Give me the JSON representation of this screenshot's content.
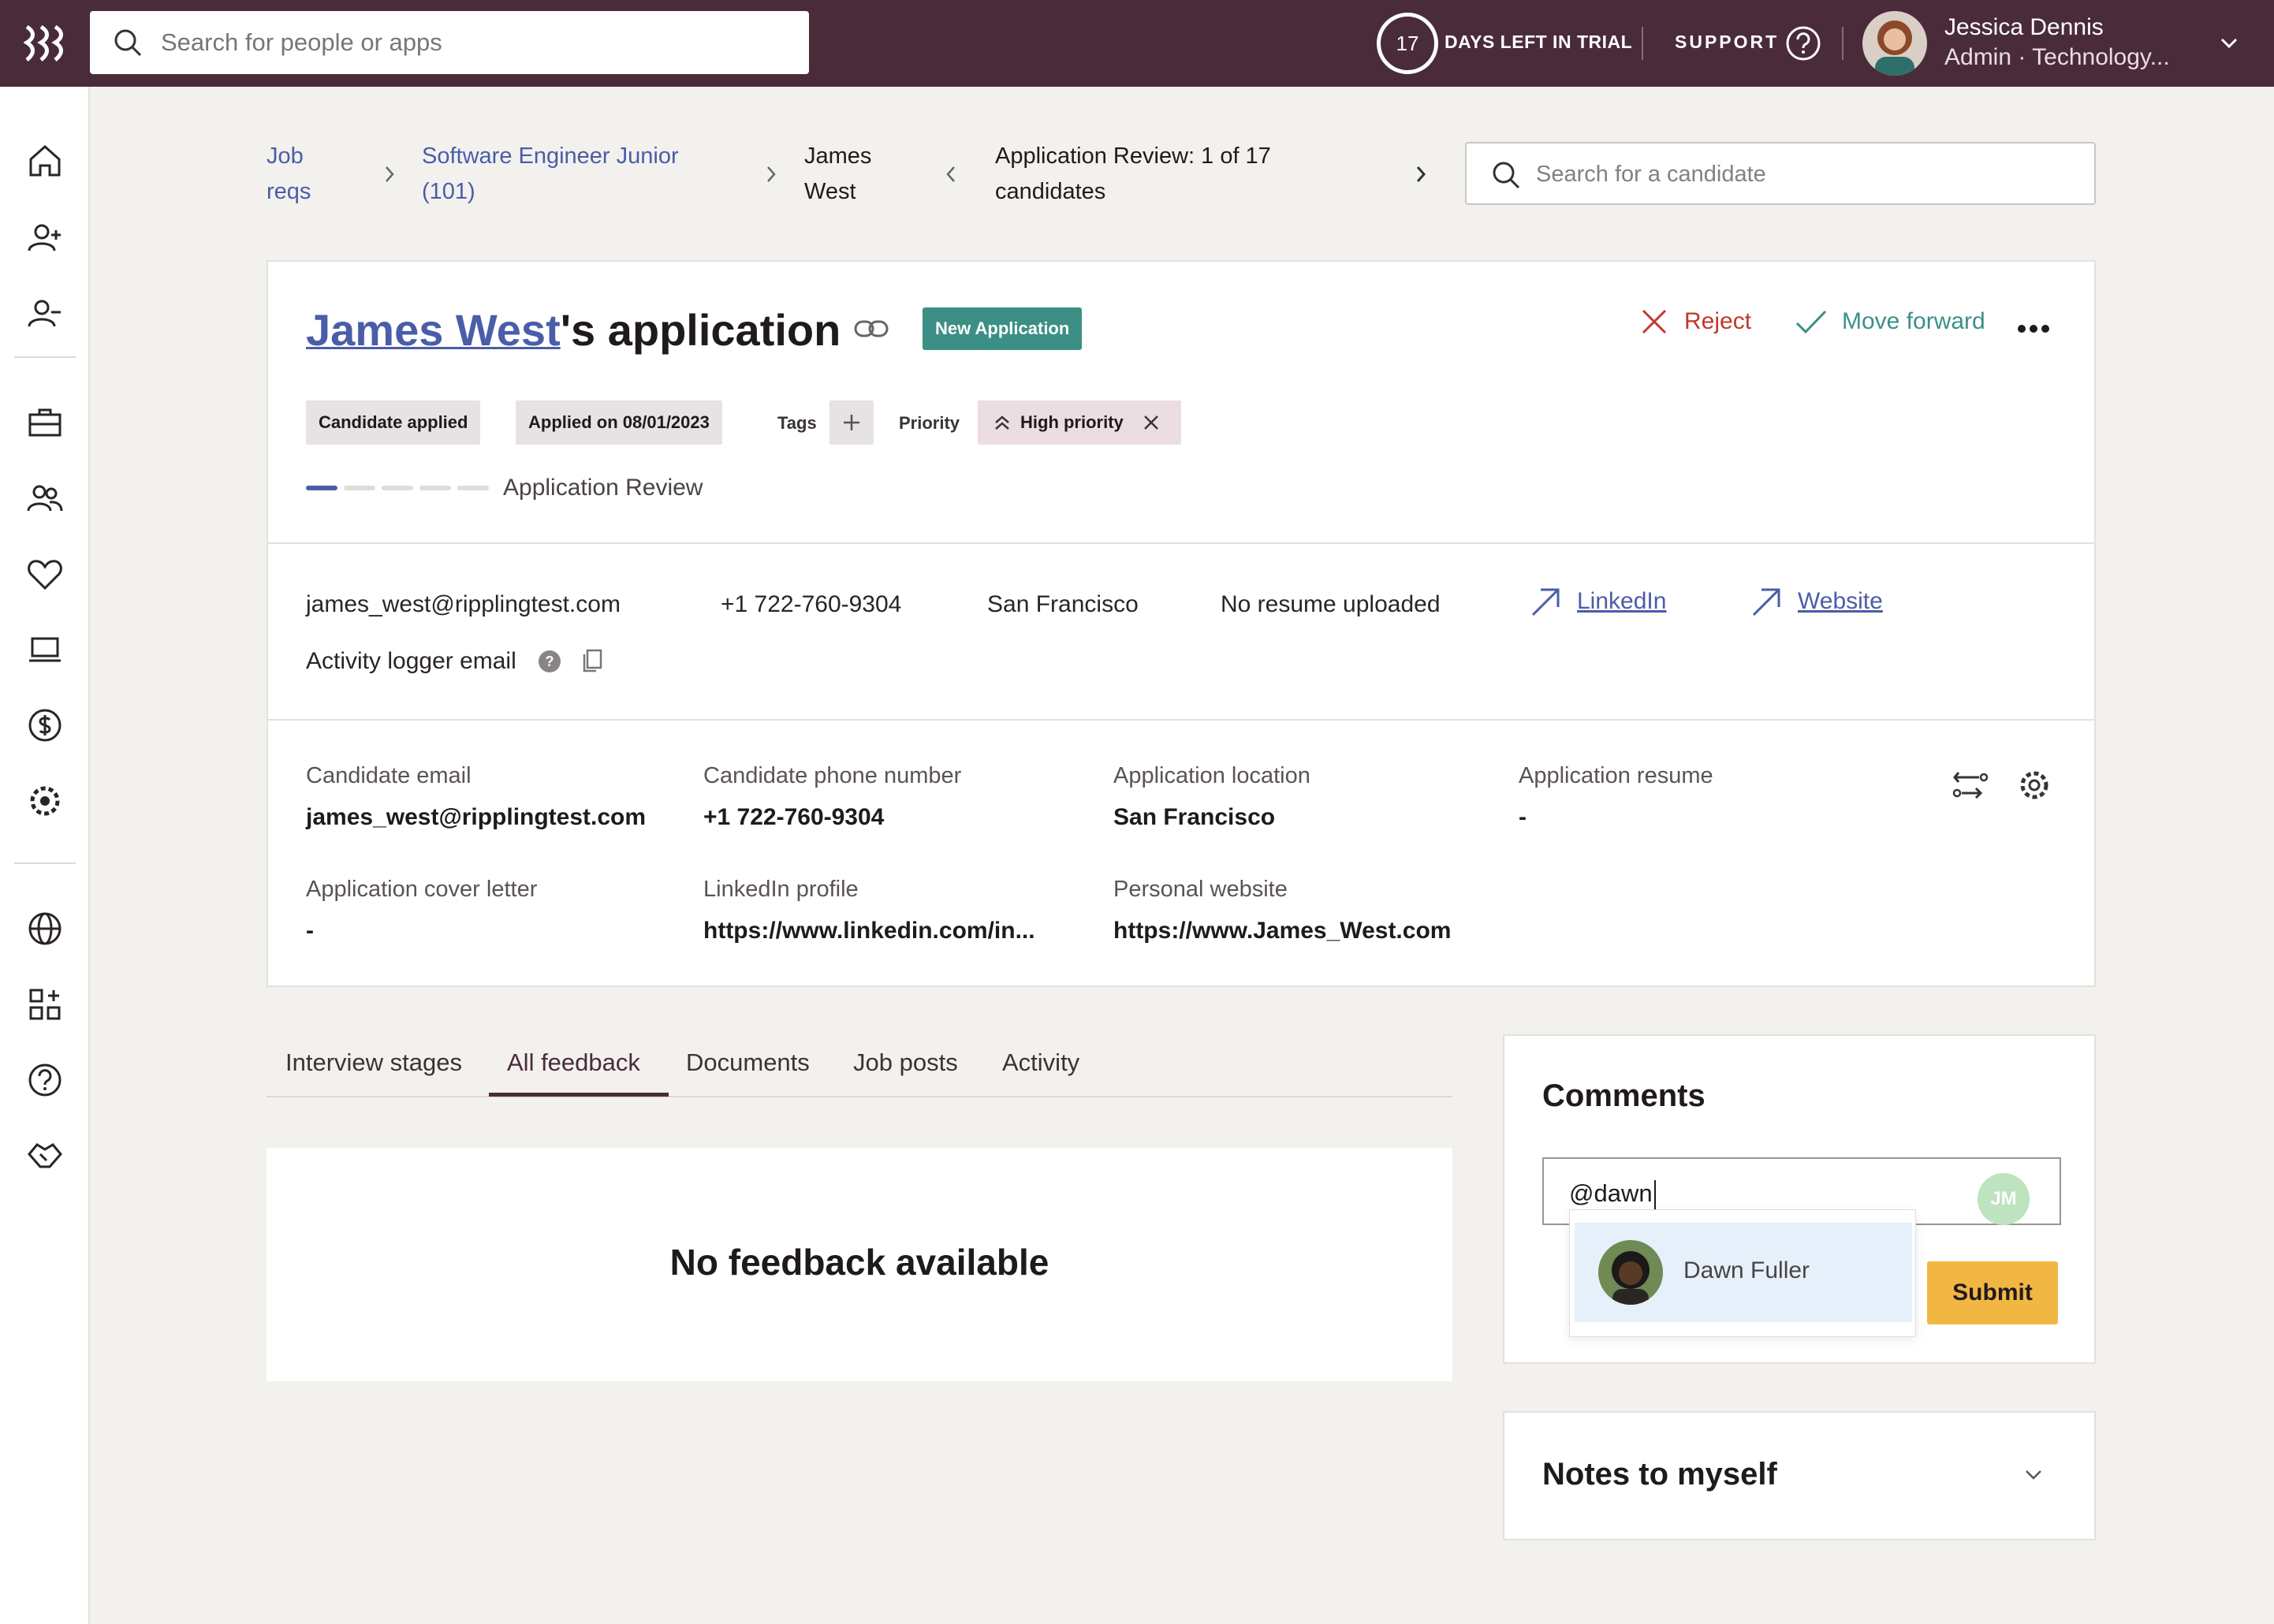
{
  "topbar": {
    "search_placeholder": "Search for people or apps",
    "trial_days": "17",
    "trial_text": "DAYS LEFT IN TRIAL",
    "support": "SUPPORT",
    "user_name": "Jessica Dennis",
    "user_role": "Admin · Technology..."
  },
  "breadcrumb": {
    "job_reqs_line1": "Job",
    "job_reqs_line2": "reqs",
    "job_line1": "Software Engineer Junior",
    "job_line2": "(101)",
    "candidate_line1": "James",
    "candidate_line2": "West",
    "review_line1": "Application Review: 1 of 17",
    "review_line2": "candidates",
    "candidate_search_placeholder": "Search for a candidate"
  },
  "application": {
    "candidate_name": "James West",
    "title_suffix": "'s application",
    "status_badge": "New Application",
    "reject_label": "Reject",
    "move_forward_label": "Move forward",
    "chip_applied": "Candidate applied",
    "chip_applied_on": "Applied on 08/01/2023",
    "tags_label": "Tags",
    "priority_label": "Priority",
    "priority_value": "High priority",
    "stage_label": "Application Review",
    "stage_progress": {
      "current": 1,
      "total": 5
    }
  },
  "contact": {
    "email": "james_west@ripplingtest.com",
    "phone": "+1 722-760-9304",
    "location": "San Francisco",
    "resume": "No resume uploaded",
    "linkedin": "LinkedIn",
    "website": "Website",
    "activity_logger": "Activity logger email"
  },
  "fields": {
    "candidate_email_label": "Candidate email",
    "candidate_email": "james_west@ripplingtest.com",
    "candidate_phone_label": "Candidate phone number",
    "candidate_phone": "+1 722-760-9304",
    "location_label": "Application location",
    "location": "San Francisco",
    "resume_label": "Application resume",
    "resume": "-",
    "cover_letter_label": "Application cover letter",
    "cover_letter": "-",
    "linkedin_label": "LinkedIn profile",
    "linkedin": "https://www.linkedin.com/in...",
    "website_label": "Personal website",
    "website": "https://www.James_West.com"
  },
  "tabs": {
    "interview_stages": "Interview stages",
    "all_feedback": "All feedback",
    "documents": "Documents",
    "job_posts": "Job posts",
    "activity": "Activity",
    "active": "All feedback"
  },
  "feedback": {
    "empty_message": "No feedback available"
  },
  "comments": {
    "title": "Comments",
    "input_value": "@dawn",
    "avatar_initials": "JM",
    "mention_suggestion": "Dawn Fuller",
    "submit_label": "Submit"
  },
  "notes": {
    "title": "Notes to myself"
  },
  "colors": {
    "topbar": "#4a2b3a",
    "link": "#4a5da8",
    "badge": "#3c8f84",
    "reject": "#c0392b",
    "move_forward": "#3d8f86",
    "submit": "#f2b742"
  }
}
